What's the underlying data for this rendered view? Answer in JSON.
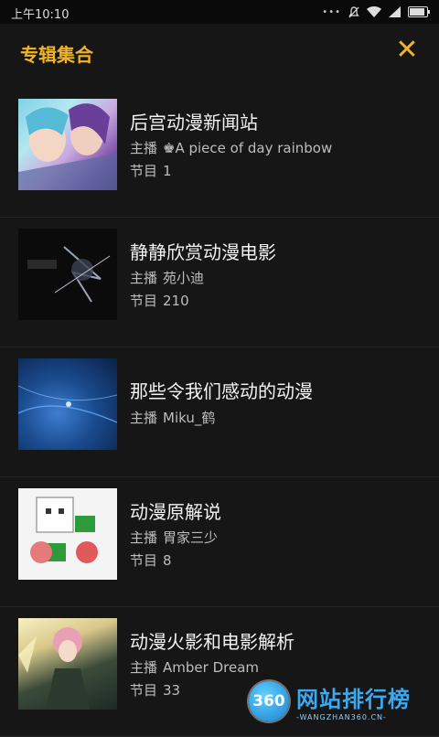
{
  "statusbar": {
    "time": "上午10:10",
    "icons": [
      "signal-dots-icon",
      "mute-icon",
      "wifi-icon",
      "signal-icon",
      "battery-icon"
    ]
  },
  "header": {
    "title": "专辑集合",
    "close_icon": "close-icon"
  },
  "albums": [
    {
      "name": "后宫动漫新闻站",
      "host_label": "主播",
      "host": "♚A piece of day rainbow",
      "count_label": "节目",
      "count": "1"
    },
    {
      "name": "静静欣赏动漫电影",
      "host_label": "主播",
      "host": "苑小迪",
      "count_label": "节目",
      "count": "210"
    },
    {
      "name": "那些令我们感动的动漫",
      "host_label": "主播",
      "host": "Miku_鹤"
    },
    {
      "name": "动漫原解说",
      "host_label": "主播",
      "host": "胃家三少",
      "count_label": "节目",
      "count": "8"
    },
    {
      "name": "动漫火影和电影解析",
      "host_label": "主播",
      "host": "Amber Dream",
      "count_label": "节目",
      "count": "33"
    }
  ],
  "watermark": {
    "badge": "360",
    "main": "网站排行榜",
    "sub": "-WANGZHAN360.CN-"
  },
  "colors": {
    "accent": "#f0b429",
    "background": "#161616"
  }
}
